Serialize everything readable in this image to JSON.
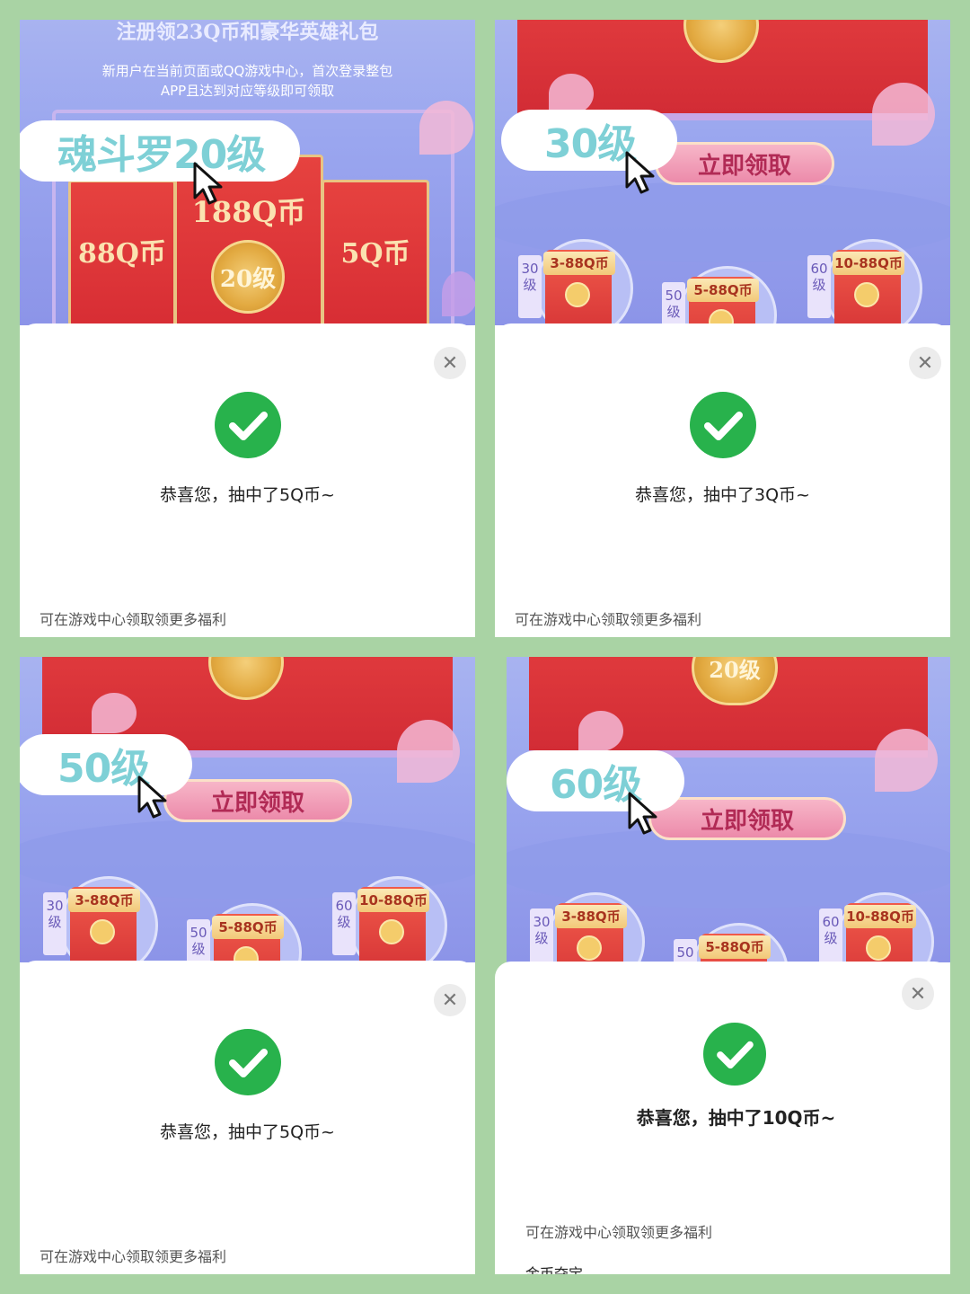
{
  "panel1": {
    "banner_title": "注册领23Q币和豪华英雄礼包",
    "banner_intro_1": "新用户在当前页面或QQ游戏中心，首次登录整包",
    "banner_intro_2": "APP且达到对应等级即可领取",
    "callout": "魂斗罗20级",
    "env_left": "88Q币",
    "env_mid": "188Q币",
    "env_right": "5Q币",
    "coin": "20级",
    "dialog_msg": "恭喜您，抽中了5Q币~",
    "footnote": "可在游戏中心领取领更多福利"
  },
  "panel2": {
    "callout": "30级",
    "claim": "立即领取",
    "rewards": [
      {
        "level": "30级",
        "amount": "3-88Q币"
      },
      {
        "level": "50级",
        "amount": "5-88Q币"
      },
      {
        "level": "60级",
        "amount": "10-88Q币"
      }
    ],
    "dialog_msg": "恭喜您，抽中了3Q币~",
    "footnote": "可在游戏中心领取领更多福利"
  },
  "panel3": {
    "callout": "50级",
    "claim": "立即领取",
    "rewards": [
      {
        "level": "30级",
        "amount": "3-88Q币"
      },
      {
        "level": "50级",
        "amount": "5-88Q币"
      },
      {
        "level": "60级",
        "amount": "10-88Q币"
      }
    ],
    "dialog_msg": "恭喜您，抽中了5Q币~",
    "footnote": "可在游戏中心领取领更多福利"
  },
  "panel4": {
    "callout": "60级",
    "coin": "20级",
    "claim": "立即领取",
    "rewards": [
      {
        "level": "30级",
        "amount": "3-88Q币"
      },
      {
        "level": "50",
        "amount": "5-88Q币"
      },
      {
        "level": "60级",
        "amount": "10-88Q币"
      }
    ],
    "dialog_msg": "恭喜您，抽中了10Q币~",
    "footnote": "可在游戏中心领取领更多福利",
    "footnote2": "金币夺宝"
  },
  "icons": {
    "close": "close-icon",
    "success": "check-circle-icon",
    "cursor": "mouse-pointer-icon"
  },
  "colors": {
    "success": "#28b24c",
    "callout_text": "#7ed0d6",
    "background": "#a9d3a4"
  }
}
